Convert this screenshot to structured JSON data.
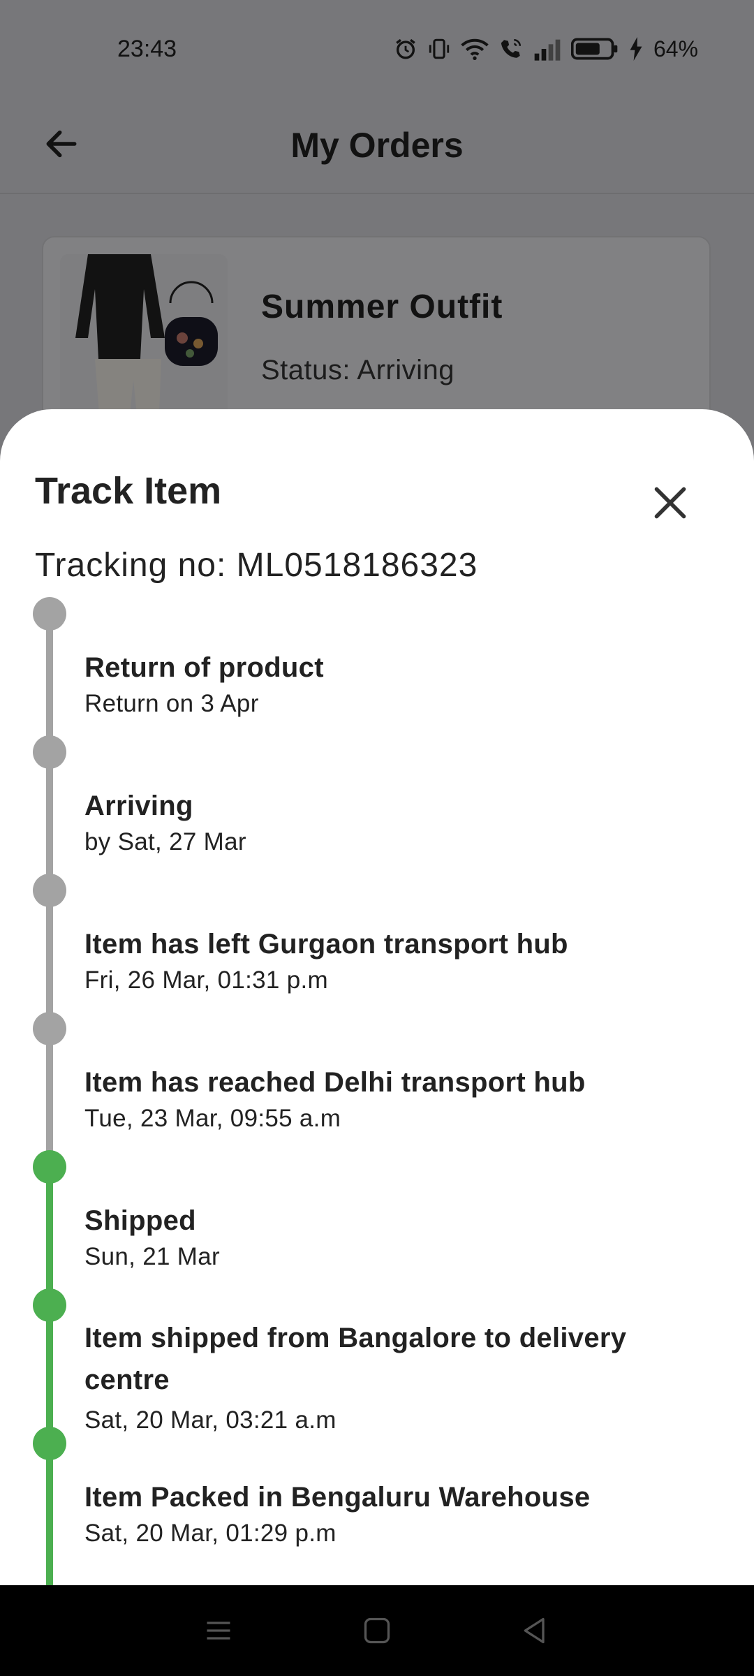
{
  "status_bar": {
    "time": "23:43",
    "battery": "64%",
    "icons": [
      "alarm-icon",
      "vibrate-icon",
      "wifi-icon",
      "wifi-call-icon",
      "signal-icon",
      "battery-icon",
      "charging-icon"
    ]
  },
  "app_bar": {
    "title": "My Orders",
    "back_icon": "arrow-left-icon"
  },
  "order": {
    "name": "Summer Outfit",
    "status": "Status: Arriving"
  },
  "sheet": {
    "title": "Track Item",
    "close_icon": "close-icon",
    "tracking": "Tracking no: ML0518186323",
    "colors": {
      "pending": "#a3a3a3",
      "done": "#4caf50"
    },
    "events": [
      {
        "title": "Return of product",
        "sub": "Return on 3 Apr",
        "state": "pending"
      },
      {
        "title": "Arriving",
        "sub": "by Sat, 27 Mar",
        "state": "pending"
      },
      {
        "title": "Item has left Gurgaon transport hub",
        "sub": "Fri, 26 Mar, 01:31 p.m",
        "state": "pending"
      },
      {
        "title": "Item has reached Delhi transport hub",
        "sub": "Tue, 23 Mar, 09:55 a.m",
        "state": "pending"
      },
      {
        "title": "Shipped",
        "sub": "Sun, 21 Mar",
        "state": "done"
      },
      {
        "title": "Item shipped from Bangalore to delivery centre",
        "sub": "Sat, 20 Mar, 03:21 a.m",
        "state": "done"
      },
      {
        "title": "Item Packed in Bengaluru Warehouse",
        "sub": "Sat, 20 Mar, 01:29 p.m",
        "state": "done"
      }
    ]
  },
  "nav_bar": {
    "icons": [
      "menu-icon",
      "home-square-icon",
      "back-triangle-icon"
    ]
  }
}
